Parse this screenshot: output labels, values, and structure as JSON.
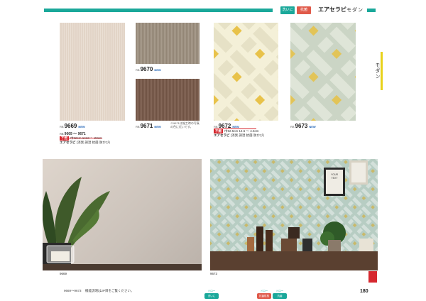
{
  "header": {
    "badge_1": "洗いに",
    "badge_2": "抗菌",
    "title": "エアセラピ",
    "subtitle": "モダン",
    "colors": {
      "accent": "#1aa89a",
      "badge_1": "#1aa89a",
      "badge_2": "#e05a4a"
    }
  },
  "swatches": [
    {
      "prefix": "RB",
      "code": "9669",
      "new": "NEW"
    },
    {
      "prefix": "RB",
      "code": "9670",
      "new": "NEW"
    },
    {
      "prefix": "RB",
      "code": "9671",
      "new": "NEW"
    },
    {
      "prefix": "RB",
      "code": "9672",
      "new": "NEW"
    },
    {
      "prefix": "RB",
      "code": "9673",
      "new": "NEW"
    }
  ],
  "note_9671": [
    "※9671は施工時の写真",
    "の色に近いです。"
  ],
  "spec_left": {
    "range": "9669 ～ 9671",
    "badge": "不燃",
    "size": "巾92cm 1413 ～ 23cm",
    "brand": "エアセラピ",
    "features": "(消臭 調湿 抗菌 防かび)"
  },
  "spec_right": {
    "badge": "不燃",
    "size": "巾92.5cm 14.6 ～ 4.6cm",
    "brand": "エアセラピ",
    "features": "(消臭 調湿 抗菌 防かび)"
  },
  "side_tab": {
    "label": "モダン",
    "color": "#e8d21a"
  },
  "photos": [
    {
      "caption": "9669"
    },
    {
      "caption": "9673",
      "sign": [
        "YOUR",
        "TEXT"
      ]
    }
  ],
  "footer": {
    "left_codes": "9669～9673",
    "left_note": "機能説明は2P目をご覧ください。",
    "page": "180",
    "icons": [
      {
        "top": "ドロー",
        "bottom": "洗いに"
      },
      {
        "top": "ドロー",
        "bottom": "抗菌防臭"
      },
      {
        "top": "ドロー",
        "bottom": "抗菌"
      }
    ],
    "colors": {
      "red": "#d6282f"
    }
  }
}
